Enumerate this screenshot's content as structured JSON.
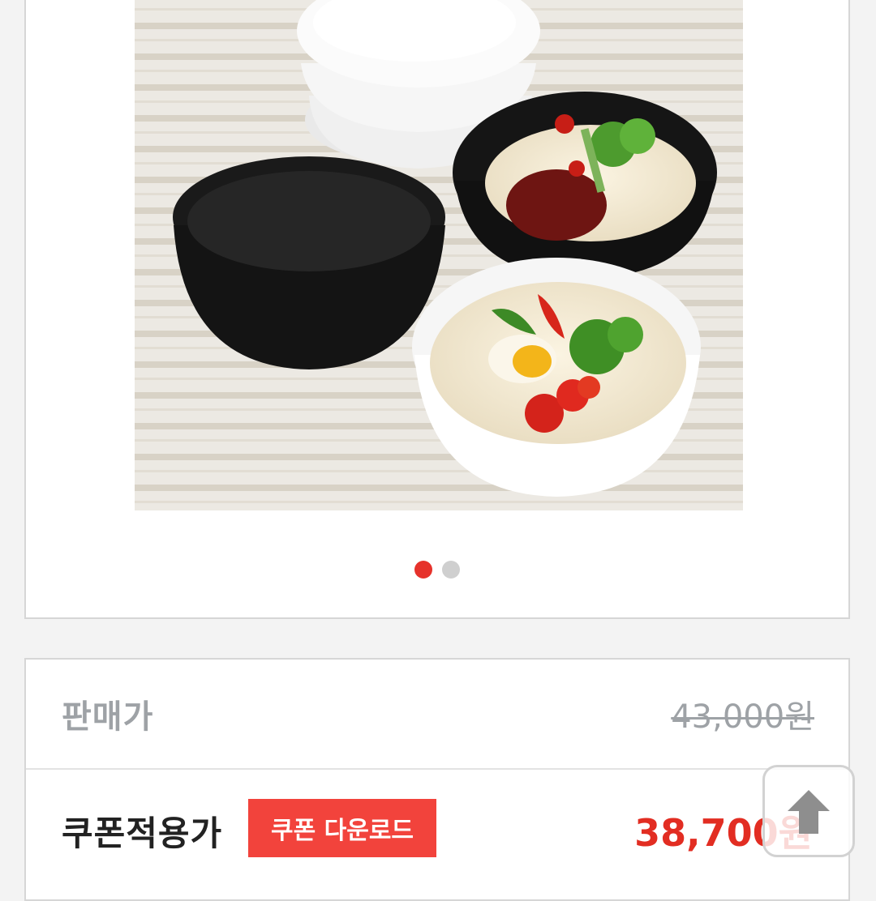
{
  "gallery": {
    "image": "bowl-noodle-product-photo",
    "slides_total": 2,
    "active_slide": 1
  },
  "price": {
    "sale_label": "판매가",
    "sale_value": "43,000원",
    "coupon_label": "쿠폰적용가",
    "coupon_button": "쿠폰 다운로드",
    "coupon_value": "38,700원"
  },
  "colors": {
    "accent": "#e6322b",
    "button": "#f2433c",
    "muted_text": "#9ea2a6",
    "price_red": "#e22d22"
  },
  "icons": {
    "scroll_top": "arrow-up-icon"
  }
}
